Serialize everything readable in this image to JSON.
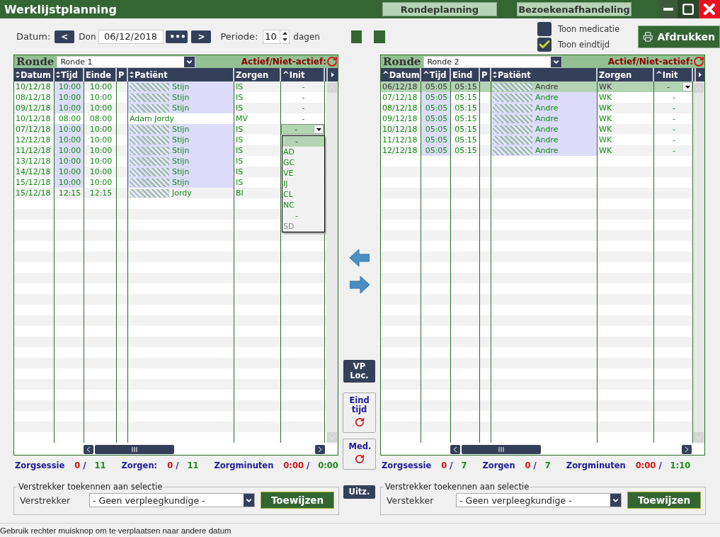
{
  "window": {
    "title": "Werklijstplanning"
  },
  "nav_tabs": [
    {
      "label": "Rondeplanning"
    },
    {
      "label": "Bezoekenafhandeling"
    }
  ],
  "toolbar": {
    "date_label": "Datum:",
    "prev": "<",
    "day": "Don",
    "date": "06/12/2018",
    "more": "•••",
    "next": ">",
    "period_label": "Periode:",
    "period": "10",
    "period_unit": "dagen"
  },
  "options": [
    {
      "label": "Toon medicatie",
      "checked": false
    },
    {
      "label": "Toon eindtijd",
      "checked": true
    }
  ],
  "print_button": "Afdrukken",
  "panels": [
    {
      "title": "Ronde",
      "ronde": "Ronde 1",
      "active_label": "Actief/Niet-actief:",
      "columns": [
        {
          "label": "Datum",
          "sortable": true
        },
        {
          "label": "Tijd",
          "sortable": true
        },
        {
          "label": "Einde",
          "sortable": false
        },
        {
          "label": "P",
          "sortable": false
        },
        {
          "label": "Patiënt",
          "sortable": true
        },
        {
          "label": "Zorgen",
          "sortable": false
        },
        {
          "label": "^Init",
          "sortable": false
        }
      ],
      "rows": [
        {
          "date": "10/12/18",
          "time": "10:00",
          "end": "10:00",
          "patient": "Stijn",
          "redacted": true,
          "care": "IS",
          "init": "-",
          "highlighted": true,
          "selected": false,
          "editing": false
        },
        {
          "date": "08/12/18",
          "time": "10:00",
          "end": "10:00",
          "patient": "Stijn",
          "redacted": true,
          "care": "IS",
          "init": "-",
          "highlighted": true,
          "selected": false,
          "editing": false
        },
        {
          "date": "09/12/18",
          "time": "10:00",
          "end": "10:00",
          "patient": "Stijn",
          "redacted": true,
          "care": "IS",
          "init": "-",
          "highlighted": true,
          "selected": false,
          "editing": false
        },
        {
          "date": "10/12/18",
          "time": "08:00",
          "end": "08:00",
          "patient": "Adam Jordy",
          "redacted": false,
          "care": "MV",
          "init": "-",
          "highlighted": false,
          "selected": false,
          "editing": false
        },
        {
          "date": "07/12/18",
          "time": "10:00",
          "end": "10:00",
          "patient": "Stijn",
          "redacted": true,
          "care": "IS",
          "init": "-",
          "highlighted": true,
          "selected": false,
          "editing": true
        },
        {
          "date": "12/12/18",
          "time": "10:00",
          "end": "10:00",
          "patient": "Stijn",
          "redacted": true,
          "care": "IS",
          "highlighted": true,
          "selected": false,
          "editing": false
        },
        {
          "date": "11/12/18",
          "time": "10:00",
          "end": "10:00",
          "patient": "Stijn",
          "redacted": true,
          "care": "IS",
          "highlighted": true,
          "selected": false,
          "editing": false
        },
        {
          "date": "13/12/18",
          "time": "10:00",
          "end": "10:00",
          "patient": "Stijn",
          "redacted": true,
          "care": "IS",
          "highlighted": true,
          "selected": false,
          "editing": false
        },
        {
          "date": "14/12/18",
          "time": "10:00",
          "end": "10:00",
          "patient": "Stijn",
          "redacted": true,
          "care": "IS",
          "highlighted": true,
          "selected": false,
          "editing": false
        },
        {
          "date": "15/12/18",
          "time": "10:00",
          "end": "10:00",
          "patient": "Stijn",
          "redacted": true,
          "care": "IS",
          "highlighted": true,
          "selected": false,
          "editing": false
        },
        {
          "date": "15/12/18",
          "time": "12:15",
          "end": "12:15",
          "patient": "Jordy",
          "redacted": true,
          "care": "BI",
          "highlighted": false,
          "selected": false,
          "editing": false
        }
      ],
      "dropdown_options": [
        {
          "label": "-",
          "selected": true,
          "disabled": false
        },
        {
          "label": "AD",
          "selected": false,
          "disabled": false
        },
        {
          "label": "GC",
          "selected": false,
          "disabled": false
        },
        {
          "label": "VE",
          "selected": false,
          "disabled": false
        },
        {
          "label": "IJ",
          "selected": false,
          "disabled": false
        },
        {
          "label": "CL",
          "selected": false,
          "disabled": false
        },
        {
          "label": "NC",
          "selected": false,
          "disabled": false
        },
        {
          "label": "-",
          "selected": false,
          "disabled": false
        },
        {
          "label": "SD",
          "selected": false,
          "disabled": true
        }
      ],
      "stats": [
        {
          "label": "Zorgsessie",
          "done": "0",
          "separator": "/",
          "total": "11"
        },
        {
          "label": "Zorgen:",
          "done": "0",
          "separator": "/",
          "total": "11"
        },
        {
          "label": "Zorgminuten",
          "done": "0:00",
          "separator": "/",
          "total": "0:00"
        }
      ],
      "assign": {
        "legend": "Verstrekker toekennen aan selectie",
        "label": "Verstrekker",
        "select": "- Geen verpleegkundige -",
        "button": "Toewijzen"
      }
    },
    {
      "title": "Ronde",
      "ronde": "Ronde 2",
      "active_label": "Actief/Niet-actief:",
      "columns": [
        {
          "label": "^Datum",
          "sortable": false
        },
        {
          "label": "^Tijd",
          "sortable": false
        },
        {
          "label": "Eind",
          "sortable": false
        },
        {
          "label": "P",
          "sortable": false
        },
        {
          "label": "Patiënt",
          "sortable": true
        },
        {
          "label": "Zorgen",
          "sortable": false
        },
        {
          "label": "^Init",
          "sortable": false
        }
      ],
      "rows": [
        {
          "date": "06/12/18",
          "time": "05:05",
          "end": "05:15",
          "patient": "Andre",
          "redacted": true,
          "care": "WK",
          "init": "-",
          "highlighted": true,
          "selected": true,
          "editing": true
        },
        {
          "date": "07/12/18",
          "time": "05:05",
          "end": "05:15",
          "patient": "Andre",
          "redacted": true,
          "care": "WK",
          "init": "-",
          "highlighted": true,
          "selected": false,
          "editing": false
        },
        {
          "date": "08/12/18",
          "time": "05:05",
          "end": "05:15",
          "patient": "Andre",
          "redacted": true,
          "care": "WK",
          "init": "-",
          "highlighted": true,
          "selected": false,
          "editing": false
        },
        {
          "date": "09/12/18",
          "time": "05:05",
          "end": "05:15",
          "patient": "Andre",
          "redacted": true,
          "care": "WK",
          "init": "-",
          "highlighted": true,
          "selected": false,
          "editing": false
        },
        {
          "date": "10/12/18",
          "time": "05:05",
          "end": "05:15",
          "patient": "Andre",
          "redacted": true,
          "care": "WK",
          "init": "-",
          "highlighted": true,
          "selected": false,
          "editing": false
        },
        {
          "date": "11/12/18",
          "time": "05:05",
          "end": "05:15",
          "patient": "Andre",
          "redacted": true,
          "care": "WK",
          "init": "-",
          "highlighted": true,
          "selected": false,
          "editing": false
        },
        {
          "date": "12/12/18",
          "time": "05:05",
          "end": "05:15",
          "patient": "Andre",
          "redacted": true,
          "care": "WK",
          "init": "-",
          "highlighted": true,
          "selected": false,
          "editing": false
        }
      ],
      "stats": [
        {
          "label": "Zorgsessie",
          "done": "0",
          "separator": "/",
          "total": "7"
        },
        {
          "label": "Zorgen",
          "done": "0",
          "separator": "/",
          "total": "7"
        },
        {
          "label": "Zorgminuten",
          "done": "0:00",
          "separator": "/",
          "total": "1:10"
        }
      ],
      "assign": {
        "legend": "Verstrekker toekennen aan selectie",
        "label": "Verstekker",
        "select": "- Geen verpleegkundige -",
        "button": "Toewijzen"
      }
    }
  ],
  "side_buttons": [
    {
      "label": "VP Loc.",
      "kind": "dark"
    },
    {
      "label": "Eind tijd",
      "kind": "reset"
    },
    {
      "label": "Med.",
      "kind": "reset"
    },
    {
      "label": "Uitz.",
      "kind": "dark"
    }
  ],
  "status_bar": "Gebruik rechter muisknop om te verplaatsen naar andere datum"
}
